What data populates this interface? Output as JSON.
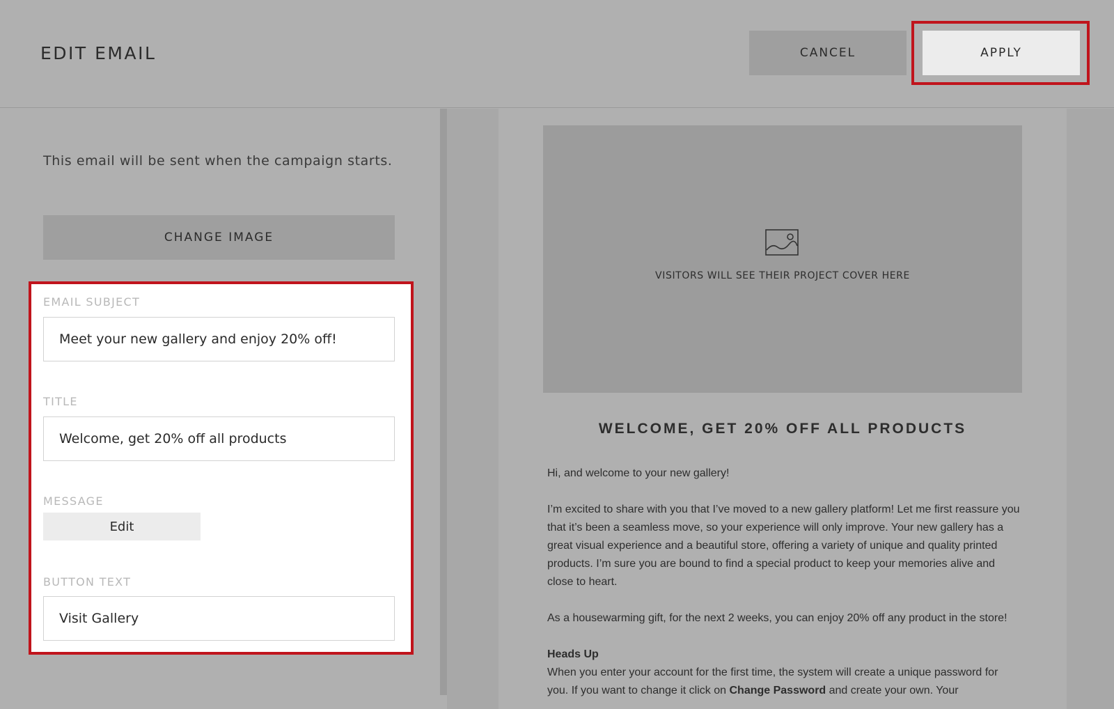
{
  "header": {
    "title": "EDIT EMAIL",
    "cancel_label": "CANCEL",
    "apply_label": "APPLY"
  },
  "left": {
    "intro": "This email will be sent when the campaign starts.",
    "change_image_label": "CHANGE IMAGE",
    "email_subject_label": "EMAIL SUBJECT",
    "email_subject_value": "Meet your new gallery and enjoy 20% off!",
    "title_label": "TITLE",
    "title_value": "Welcome, get 20% off all products",
    "message_label": "MESSAGE",
    "edit_label": "Edit",
    "button_text_label": "BUTTON TEXT",
    "button_text_value": "Visit Gallery"
  },
  "preview": {
    "cover_caption": "VISITORS WILL SEE THEIR PROJECT COVER HERE",
    "title": "WELCOME, GET 20% OFF ALL PRODUCTS",
    "greeting": "Hi, and welcome to your new gallery!",
    "paragraph1": "I’m excited to share with you that I’ve moved to a new gallery platform! Let me first reassure you that it’s been a seamless move, so your experience will only improve. Your new gallery has a great visual experience and a beautiful store, offering a variety of unique and quality printed products. I’m sure you are bound to find a special product to keep your memories alive and close to heart.",
    "paragraph2": "As a housewarming gift, for the next 2 weeks, you can enjoy 20% off any product in the store!",
    "heads_up_heading": "Heads Up",
    "heads_up_text_1": "When you enter your account for the first time, the system will create a unique password for you. If you want to change it click on ",
    "heads_up_bold": "Change Password",
    "heads_up_text_2": " and create your own. Your"
  },
  "colors": {
    "highlight": "#c0141c",
    "overlay": "#b0b0b0"
  },
  "icons": {
    "cover": "image-icon"
  }
}
